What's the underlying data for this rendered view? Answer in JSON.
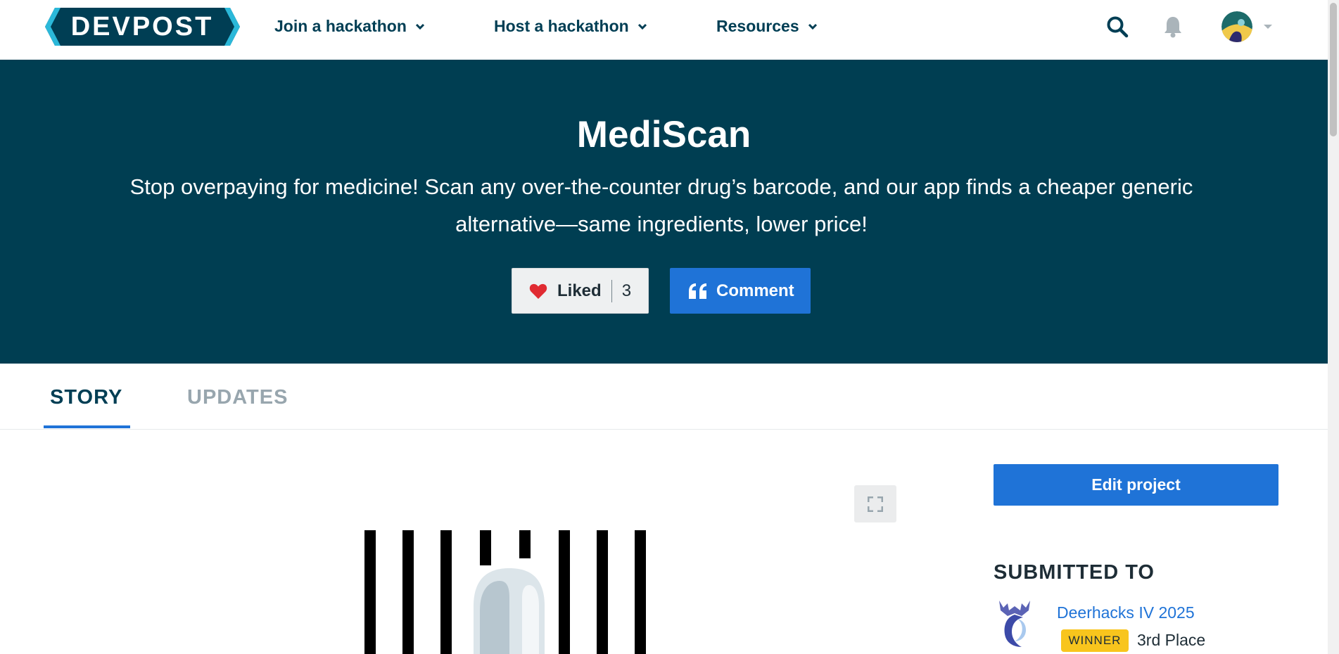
{
  "nav": {
    "logo_text": "DEVPOST",
    "join": "Join a hackathon",
    "host": "Host a hackathon",
    "resources": "Resources"
  },
  "project": {
    "title": "MediScan",
    "tagline": "Stop overpaying for medicine! Scan any over-the-counter drug’s barcode, and our app finds a cheaper generic alternative—same ingredients, lower price!",
    "like_label": "Liked",
    "like_count": "3",
    "comment_label": "Comment"
  },
  "tabs": {
    "story": "STORY",
    "updates": "UPDATES"
  },
  "sidebar": {
    "edit_label": "Edit project",
    "submitted_title": "SUBMITTED TO",
    "hackathon_name": "Deerhacks IV 2025",
    "winner_badge": "WINNER",
    "place": "3rd Place"
  },
  "colors": {
    "brand_dark": "#003e52",
    "accent_blue": "#1f73d7",
    "winner_yellow": "#f8c51d",
    "heart_red": "#e02b32"
  },
  "icons": [
    "chevron-down-icon",
    "search-icon",
    "bell-icon",
    "heart-icon",
    "quote-icon",
    "expand-icon"
  ]
}
